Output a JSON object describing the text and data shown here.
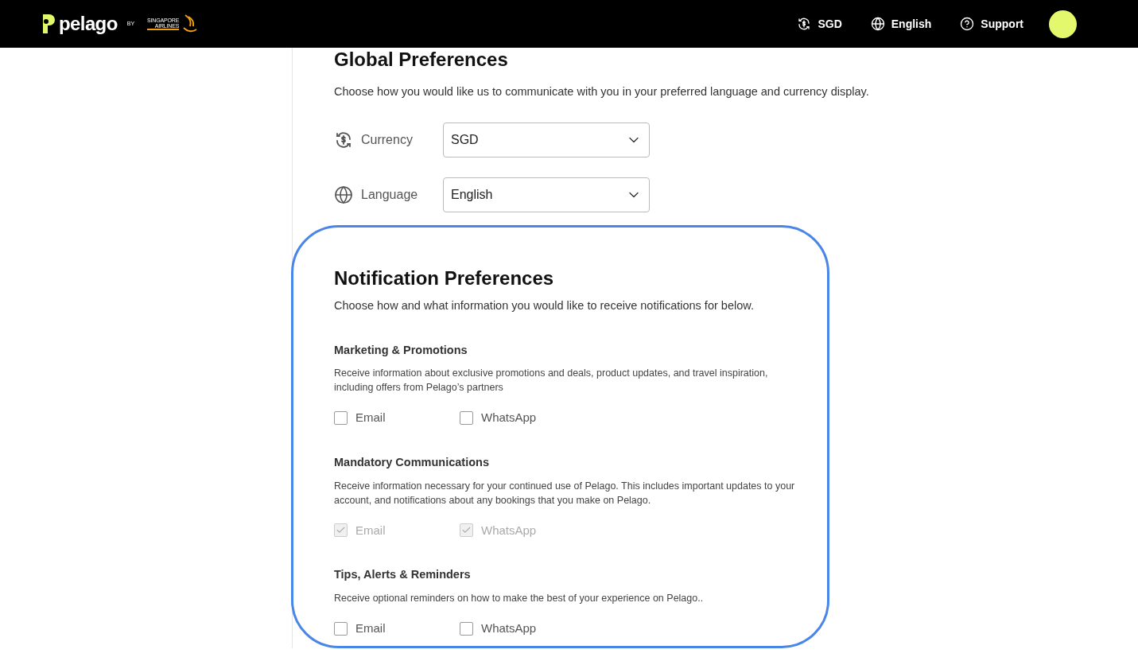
{
  "header": {
    "brand": "pelago",
    "by": "BY",
    "partner": [
      "SINGAPORE",
      "AIRLINES"
    ],
    "currency": "SGD",
    "language": "English",
    "support": "Support"
  },
  "global": {
    "title": "Global Preferences",
    "description": "Choose how you would like us to communicate with you in your preferred language and currency display.",
    "fields": [
      {
        "kind": "currency",
        "label": "Currency",
        "value": "SGD"
      },
      {
        "kind": "language",
        "label": "Language",
        "value": "English"
      }
    ]
  },
  "notifications": {
    "title": "Notification Preferences",
    "description": "Choose how and what information you would like to receive notifications for below.",
    "sections": [
      {
        "title": "Marketing & Promotions",
        "description": "Receive information about exclusive promotions and deals, product updates, and travel inspiration, including offers from Pelago’s partners",
        "options": [
          {
            "label": "Email",
            "checked": false,
            "disabled": false
          },
          {
            "label": "WhatsApp",
            "checked": false,
            "disabled": false
          }
        ]
      },
      {
        "title": "Mandatory Communications",
        "description": "Receive information necessary for your continued use of Pelago. This includes important updates to your account, and notifications about any bookings that you make on Pelago.",
        "options": [
          {
            "label": "Email",
            "checked": true,
            "disabled": true
          },
          {
            "label": "WhatsApp",
            "checked": true,
            "disabled": true
          }
        ]
      },
      {
        "title": "Tips, Alerts & Reminders",
        "description": "Receive optional reminders on how to make the best of your experience on Pelago..",
        "options": [
          {
            "label": "Email",
            "checked": false,
            "disabled": false
          },
          {
            "label": "WhatsApp",
            "checked": false,
            "disabled": false
          }
        ]
      }
    ]
  }
}
